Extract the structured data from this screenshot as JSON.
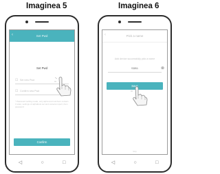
{
  "captions": {
    "left": "Imaginea 5",
    "right": "Imaginea 6"
  },
  "colors": {
    "accent": "#4ab3bd",
    "frame": "#2b2b2b"
  },
  "phone_left": {
    "appbar_title": "Set Pwd",
    "back_icon": "back-arrow-icon",
    "section_label": "Set Pwd",
    "password_placeholder": "Set new Pwd",
    "confirm_placeholder": "Confirm new Pwd",
    "note": "* Password setting made, only alpha and numbers contain 1 letter, settings of alphabets set and camera import, then password",
    "confirm_label": "Confirm"
  },
  "phone_right": {
    "appbar_title": "Pick a name",
    "back_icon": "back-arrow-icon",
    "success_text": "Add device successfully pick a name",
    "name_value": "SDB1",
    "clear_icon": "clear-icon",
    "save_label": "Save",
    "skip_label": "Skip"
  },
  "navbar": {
    "back_icon": "nav-back-icon",
    "home_icon": "nav-home-icon",
    "recent_icon": "nav-recent-icon"
  }
}
